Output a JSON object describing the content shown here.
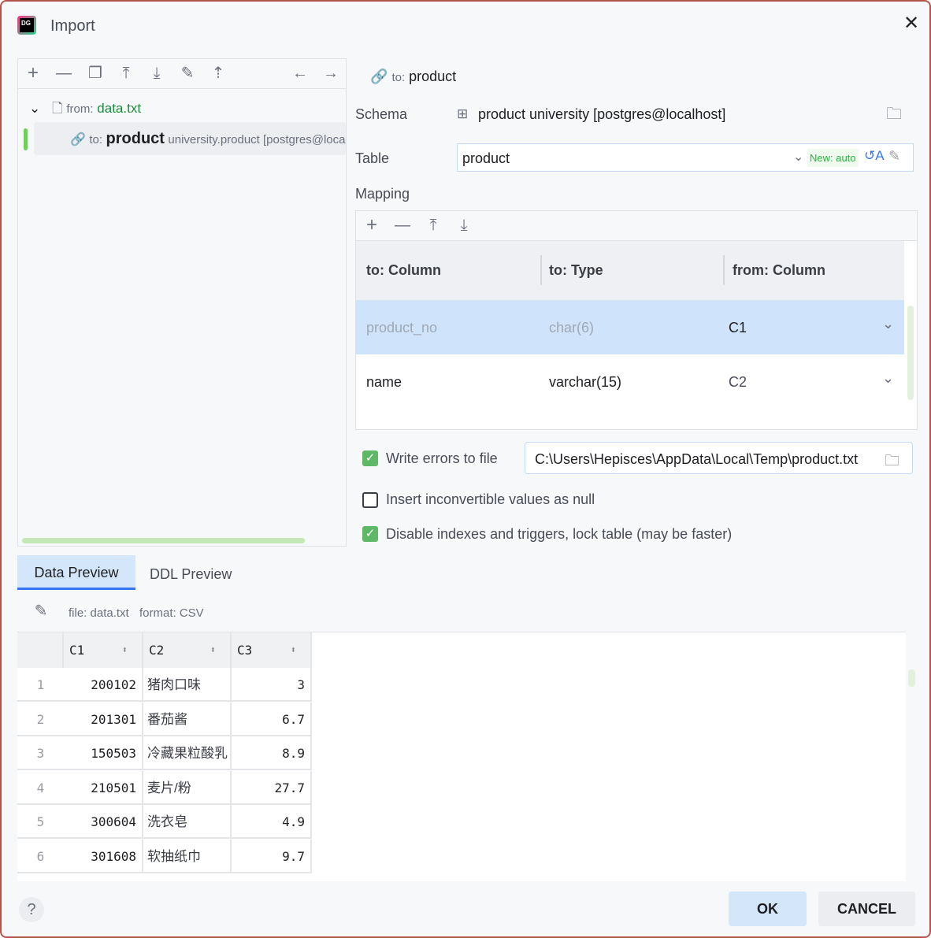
{
  "window": {
    "title": "Import"
  },
  "left": {
    "tree": {
      "source_prefix": "from:",
      "source_name": "data.txt",
      "target_prefix": "to:",
      "target_name": "product",
      "target_detail": "university.product [postgres@localhost]"
    }
  },
  "right": {
    "header_prefix": "to:",
    "header_name": "product",
    "schema_label": "Schema",
    "schema_value": "product university [postgres@localhost]",
    "table_label": "Table",
    "table_value": "product",
    "table_badge": "New: auto",
    "mapping_label": "Mapping",
    "mapping_headers": [
      "to: Column",
      "to: Type",
      "from: Column"
    ],
    "mapping_rows": [
      {
        "col": "product_no",
        "type": "char(6)",
        "from": "C1"
      },
      {
        "col": "name",
        "type": "varchar(15)",
        "from": "C2"
      }
    ],
    "options": [
      {
        "label": "Write errors to file",
        "checked": true
      },
      {
        "label": "Insert inconvertible values as null",
        "checked": false
      },
      {
        "label": "Disable indexes and triggers, lock table (may be faster)",
        "checked": true
      }
    ],
    "error_file_path": "C:\\Users\\Hepisces\\AppData\\Local\\Temp\\product.txt"
  },
  "tabs": [
    {
      "label": "Data Preview",
      "active": true
    },
    {
      "label": "DDL Preview",
      "active": false
    }
  ],
  "preview": {
    "file_info": "file: data.txt",
    "format_info": "format: CSV",
    "columns": [
      "C1",
      "C2",
      "C3"
    ],
    "rows": [
      {
        "n": "1",
        "c1": "200102",
        "c2": "猪肉口味",
        "c3": "3"
      },
      {
        "n": "2",
        "c1": "201301",
        "c2": "番茄酱",
        "c3": "6.7"
      },
      {
        "n": "3",
        "c1": "150503",
        "c2": "冷藏果粒酸乳",
        "c3": "8.9"
      },
      {
        "n": "4",
        "c1": "210501",
        "c2": "麦片/粉",
        "c3": "27.7"
      },
      {
        "n": "5",
        "c1": "300604",
        "c2": "洗衣皂",
        "c3": "4.9"
      },
      {
        "n": "6",
        "c1": "301608",
        "c2": "软抽纸巾",
        "c3": "9.7"
      }
    ]
  },
  "footer": {
    "help": "?",
    "ok": "OK",
    "cancel": "CANCEL"
  }
}
